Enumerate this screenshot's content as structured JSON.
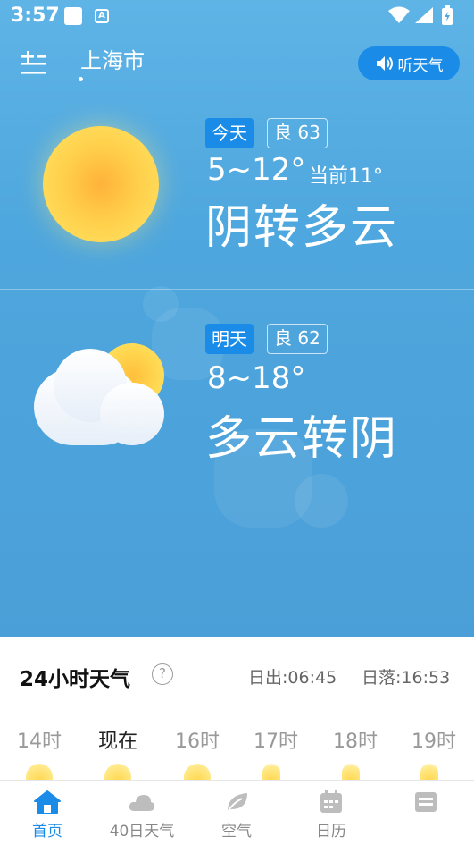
{
  "status_bar": {
    "time": "3:57",
    "notif_letter": "A"
  },
  "header": {
    "city": "上海市",
    "listen_label": "听天气"
  },
  "today": {
    "day_label": "今天",
    "aqi_label": "良 63",
    "temp_range": "5~12°",
    "current_temp": "当前11°",
    "condition": "阴转多云",
    "icon": "sun-icon"
  },
  "tomorrow": {
    "day_label": "明天",
    "aqi_label": "良 62",
    "temp_range": "8~18°",
    "condition": "多云转阴",
    "icon": "partly-cloudy-icon"
  },
  "hourly": {
    "title": "24小时天气",
    "help": "?",
    "sunrise": "日出:06:45",
    "sunset": "日落:16:53",
    "hours": [
      {
        "label": "14时"
      },
      {
        "label": "现在"
      },
      {
        "label": "16时"
      },
      {
        "label": "17时"
      },
      {
        "label": "18时"
      },
      {
        "label": "19时"
      }
    ]
  },
  "nav": {
    "items": [
      {
        "label": "首页",
        "icon": "home-icon"
      },
      {
        "label": "40日天气",
        "icon": "cloud-icon"
      },
      {
        "label": "空气",
        "icon": "leaf-icon"
      },
      {
        "label": "日历",
        "icon": "calendar-icon"
      },
      {
        "label": "",
        "icon": "more-icon"
      }
    ]
  },
  "colors": {
    "accent": "#1a8ce8",
    "sky": "#4ea7de"
  }
}
